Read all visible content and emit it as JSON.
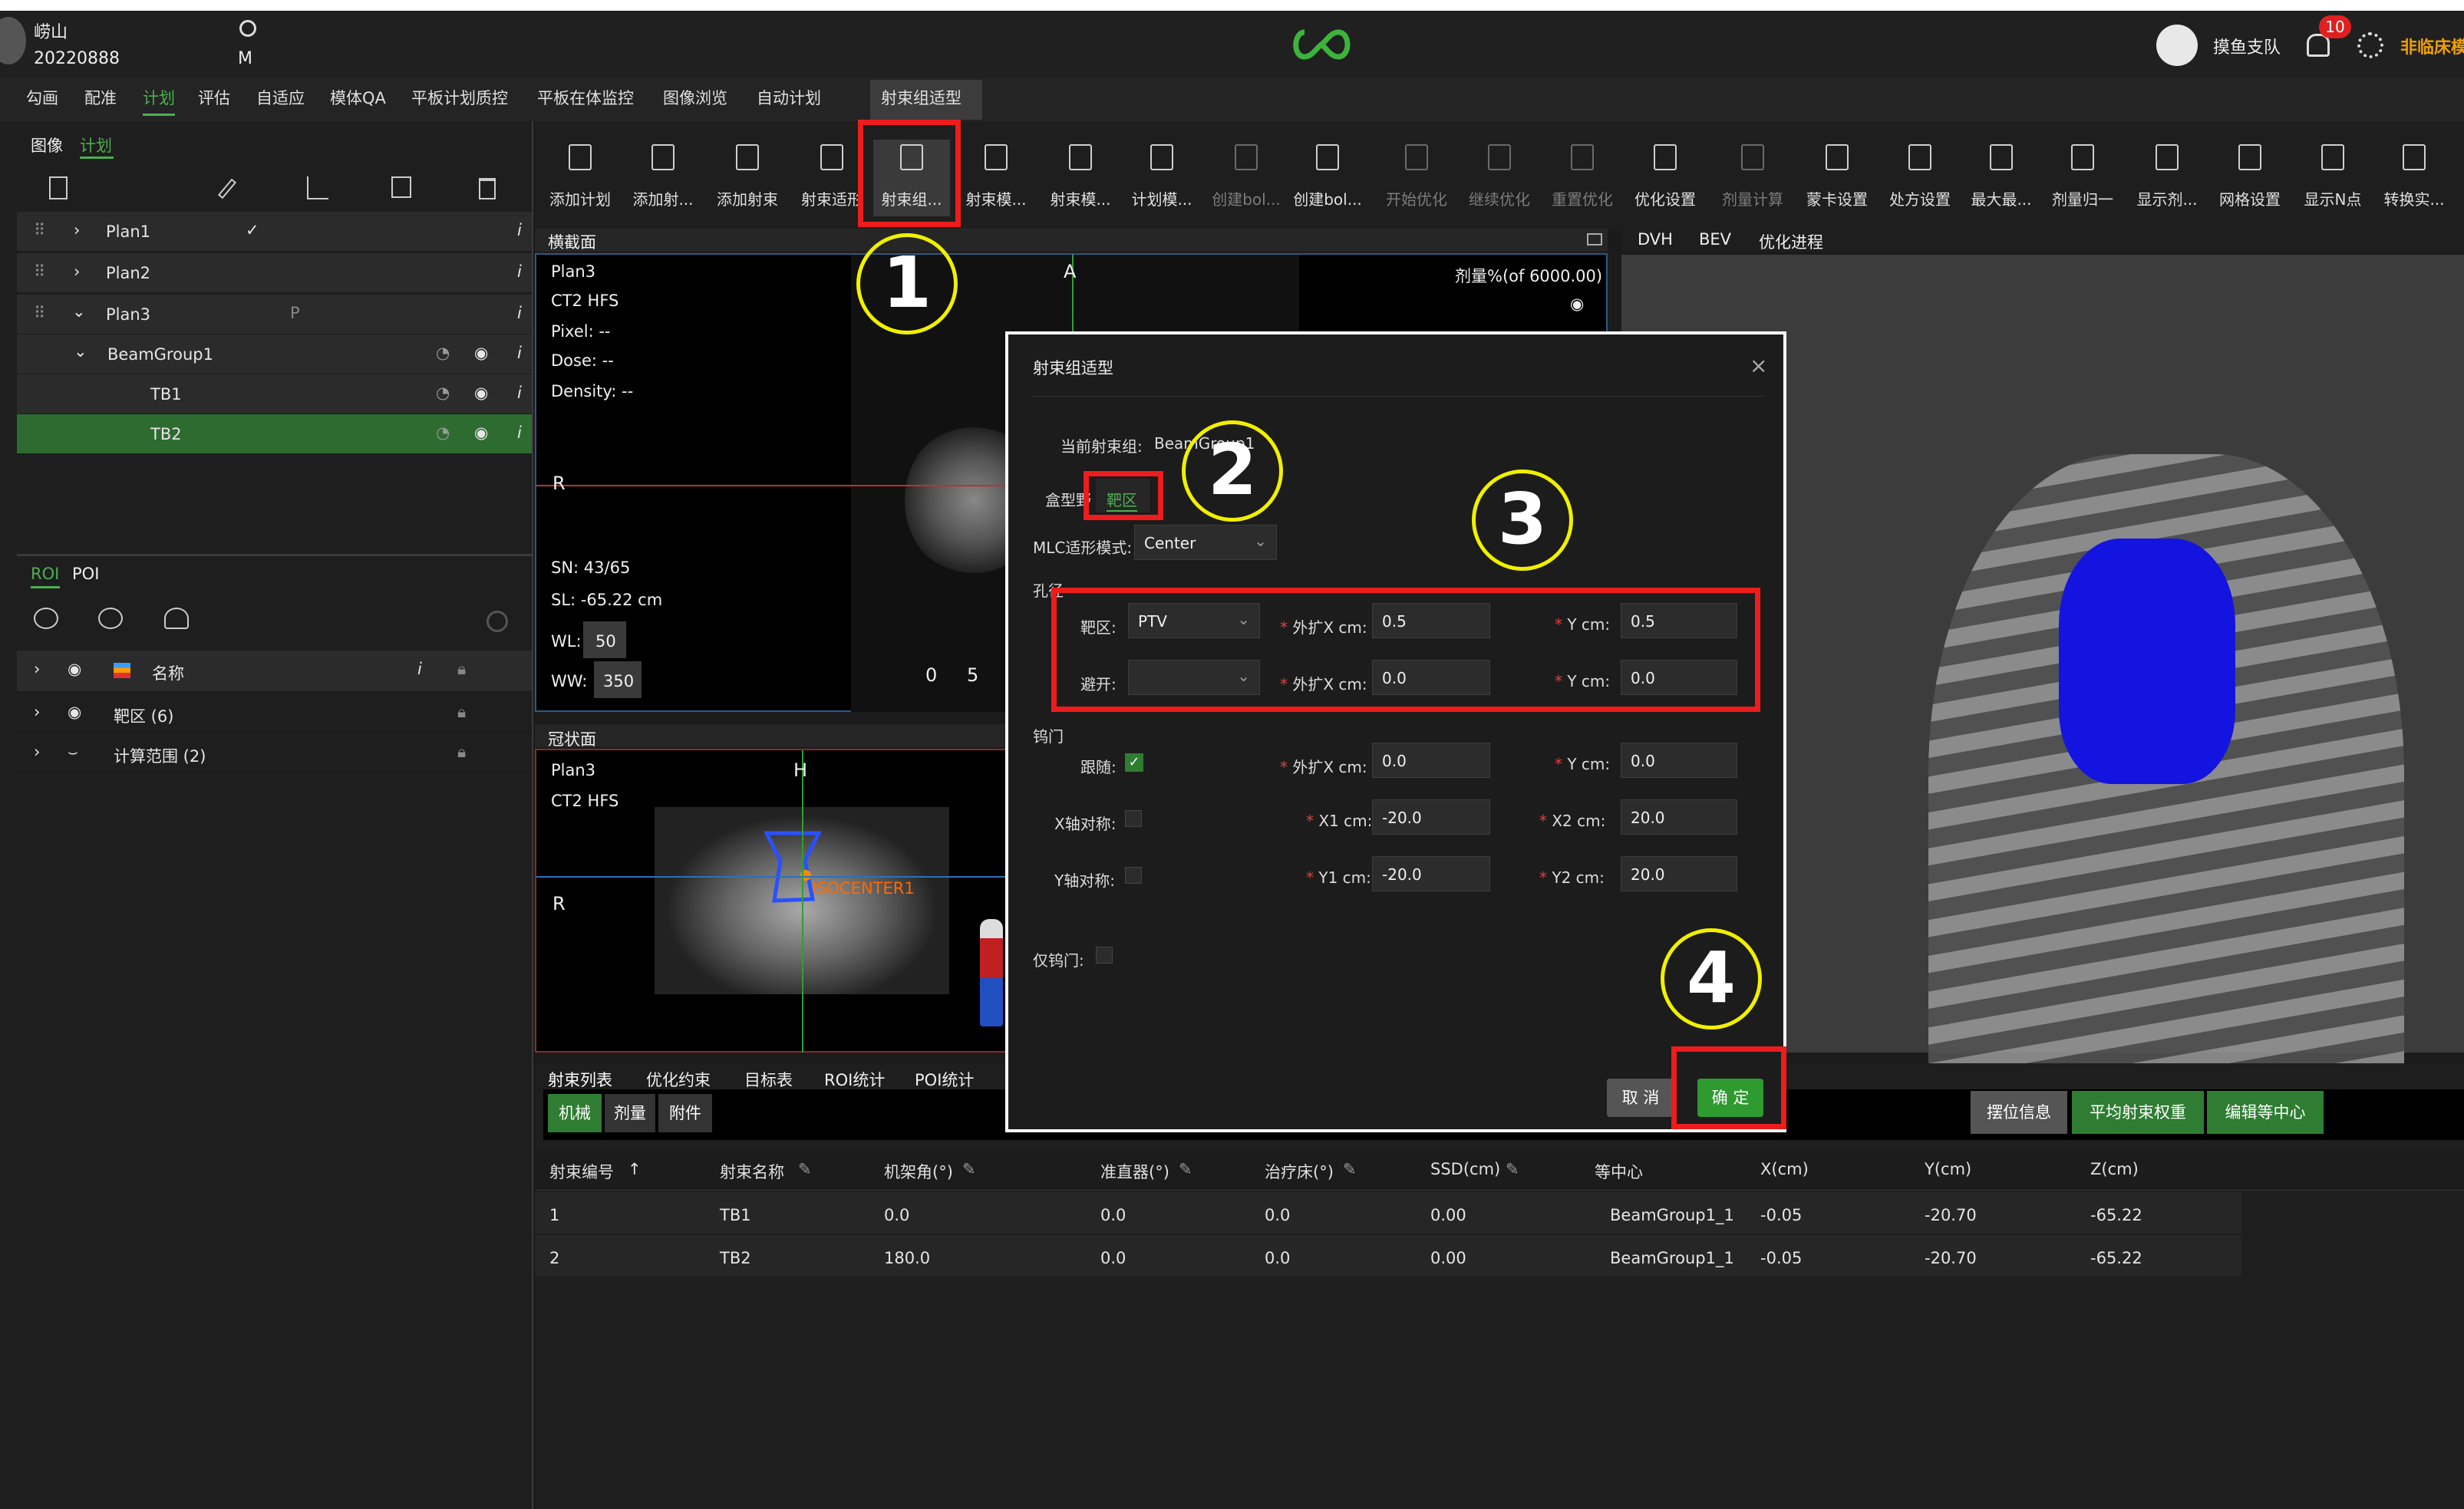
{
  "header": {
    "user_name": "崂山",
    "user_id": "20220888",
    "gender": "M",
    "team": "摸鱼支队",
    "notif_count": "10",
    "mode": "非临床模"
  },
  "menu": [
    "勾画",
    "配准",
    "计划",
    "评估",
    "自适应",
    "模体QA",
    "平板计划质控",
    "平板在体监控",
    "图像浏览",
    "自动计划",
    "射束组适型"
  ],
  "left_tabs": {
    "image": "图像",
    "plan": "计划"
  },
  "plans": [
    {
      "label": "Plan1"
    },
    {
      "label": "Plan2"
    },
    {
      "label": "Plan3"
    },
    {
      "label": "BeamGroup1"
    },
    {
      "label": "TB1"
    },
    {
      "label": "TB2"
    }
  ],
  "roi_tabs": {
    "roi": "ROI",
    "poi": "POI"
  },
  "roi_rows": [
    {
      "label": "名称"
    },
    {
      "label": "靶区 (6)"
    },
    {
      "label": "计算范围 (2)"
    }
  ],
  "toolbar": [
    {
      "label": "添加计划",
      "icon": "add-plan-icon",
      "dim": false
    },
    {
      "label": "添加射...",
      "icon": "add-beam-icon",
      "dim": false
    },
    {
      "label": "添加射束",
      "icon": "add-beam2-icon",
      "dim": false
    },
    {
      "label": "射束适形",
      "icon": "beam-conform-icon",
      "dim": false
    },
    {
      "label": "射束组...",
      "icon": "beam-group-icon",
      "dim": false
    },
    {
      "label": "射束模...",
      "icon": "beam-template-icon",
      "dim": false
    },
    {
      "label": "射束模...",
      "icon": "beam-template2-icon",
      "dim": false
    },
    {
      "label": "计划模...",
      "icon": "plan-template-icon",
      "dim": false
    },
    {
      "label": "创建bol...",
      "icon": "bolus-icon",
      "dim": true
    },
    {
      "label": "创建bol...",
      "icon": "bolus2-icon",
      "dim": false
    },
    {
      "label": "开始优化",
      "icon": "start-opt-icon",
      "dim": true
    },
    {
      "label": "继续优化",
      "icon": "continue-opt-icon",
      "dim": true
    },
    {
      "label": "重置优化",
      "icon": "reset-opt-icon",
      "dim": true
    },
    {
      "label": "优化设置",
      "icon": "opt-settings-icon",
      "dim": false
    },
    {
      "label": "剂量计算",
      "icon": "dose-calc-icon",
      "dim": true
    },
    {
      "label": "蒙卡设置",
      "icon": "montecarlo-icon",
      "dim": false
    },
    {
      "label": "处方设置",
      "icon": "prescription-icon",
      "dim": false
    },
    {
      "label": "最大最...",
      "icon": "maxmin-icon",
      "dim": false
    },
    {
      "label": "剂量归一",
      "icon": "normalize-icon",
      "dim": false
    },
    {
      "label": "显示剂...",
      "icon": "show-dose-icon",
      "dim": false
    },
    {
      "label": "网格设置",
      "icon": "grid-icon",
      "dim": false
    },
    {
      "label": "显示N点",
      "icon": "show-n-icon",
      "dim": false
    },
    {
      "label": "转换实...",
      "icon": "convert-icon",
      "dim": false
    }
  ],
  "axial": {
    "title": "横截面",
    "plan": "Plan3",
    "ct": "CT2 HFS",
    "pixel": "Pixel: --",
    "dose": "Dose: --",
    "density": "Density: --",
    "dose_ref": "剂量%(of 6000.00)",
    "r": "R",
    "a": "A",
    "sn": "SN: 43/65",
    "sl": "SL: -65.22 cm",
    "wl_label": "WL:",
    "wl": "50",
    "ww_label": "WW:",
    "ww": "350",
    "scale0": "0",
    "scale5": "5"
  },
  "coronal": {
    "title": "冠状面",
    "plan": "Plan3",
    "ct": "CT2 HFS",
    "h": "H",
    "r": "R",
    "iso": "ISOCENTER1"
  },
  "right_tabs": [
    "DVH",
    "BEV",
    "优化进程"
  ],
  "bottom_tabs": [
    "射束列表",
    "优化约束",
    "目标表",
    "ROI统计",
    "POI统计"
  ],
  "sub_tabs": [
    "机械",
    "剂量",
    "附件"
  ],
  "action_btns": [
    "摆位信息",
    "平均射束权重",
    "编辑等中心"
  ],
  "table": {
    "headers": [
      "射束编号",
      "射束名称",
      "机架角(°)",
      "准直器(°)",
      "治疗床(°)",
      "SSD(cm)",
      "等中心",
      "X(cm)",
      "Y(cm)",
      "Z(cm)"
    ],
    "rows": [
      [
        "1",
        "TB1",
        "0.0",
        "0.0",
        "0.0",
        "0.00",
        "BeamGroup1_1",
        "-0.05",
        "-20.70",
        "-65.22"
      ],
      [
        "2",
        "TB2",
        "180.0",
        "0.0",
        "0.0",
        "0.00",
        "BeamGroup1_1",
        "-0.05",
        "-20.70",
        "-65.22"
      ]
    ]
  },
  "modal": {
    "title": "射束组适型",
    "current_label": "当前射束组:",
    "current_value": "BeamGroup1",
    "tab_box": "盒型野",
    "tab_target": "靶区",
    "mlc_label": "MLC适形模式:",
    "mlc_value": "Center",
    "aperture": "孔径",
    "target_label": "靶区:",
    "target_value": "PTV",
    "avoid_label": "避开:",
    "avoid_value": "",
    "expand_x": "外扩X cm:",
    "y_cm": "Y cm:",
    "t_x": "0.5",
    "t_y": "0.5",
    "a_x": "0.0",
    "a_y": "0.0",
    "jaw": "钨门",
    "follow": "跟随:",
    "f_x": "0.0",
    "f_y": "0.0",
    "x_sym": "X轴对称:",
    "y_sym": "Y轴对称:",
    "x1": "X1 cm:",
    "x1v": "-20.0",
    "x2": "X2 cm:",
    "x2v": "20.0",
    "y1": "Y1 cm:",
    "y1v": "-20.0",
    "y2": "Y2 cm:",
    "y2v": "20.0",
    "jaw_only": "仅钨门:",
    "cancel": "取 消",
    "ok": "确 定"
  },
  "callouts": [
    "1",
    "2",
    "3",
    "4"
  ],
  "colors": {
    "accent_green": "#2e7d32",
    "callout": "#f0f000",
    "highlight": "#ee1c1c",
    "target_blue": "#1414e0"
  }
}
